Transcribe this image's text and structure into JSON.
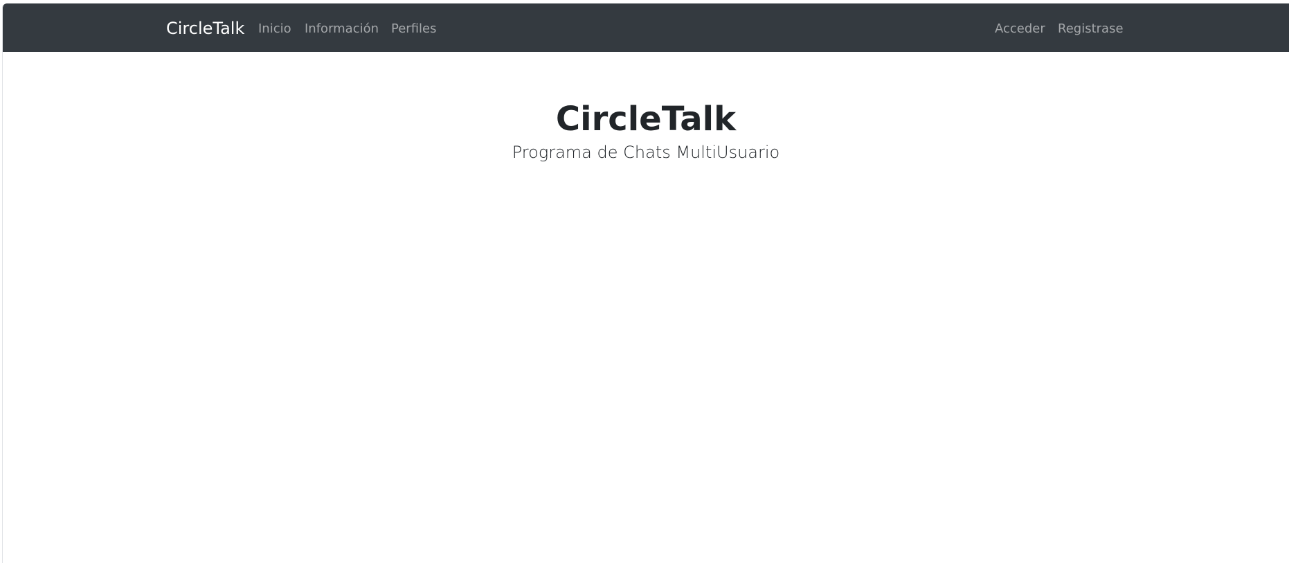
{
  "navbar": {
    "brand": "CircleTalk",
    "left_links": [
      {
        "label": "Inicio"
      },
      {
        "label": "Información"
      },
      {
        "label": "Perfiles"
      }
    ],
    "right_links": [
      {
        "label": "Acceder"
      },
      {
        "label": "Registrase"
      }
    ]
  },
  "hero": {
    "title": "CircleTalk",
    "subtitle": "Programa de Chats MultiUsuario"
  },
  "colors": {
    "navbar_bg": "#343a40",
    "brand_text": "#ffffff",
    "nav_link_text": "#8f9498",
    "body_text": "#212529",
    "page_bg": "#ffffff"
  }
}
